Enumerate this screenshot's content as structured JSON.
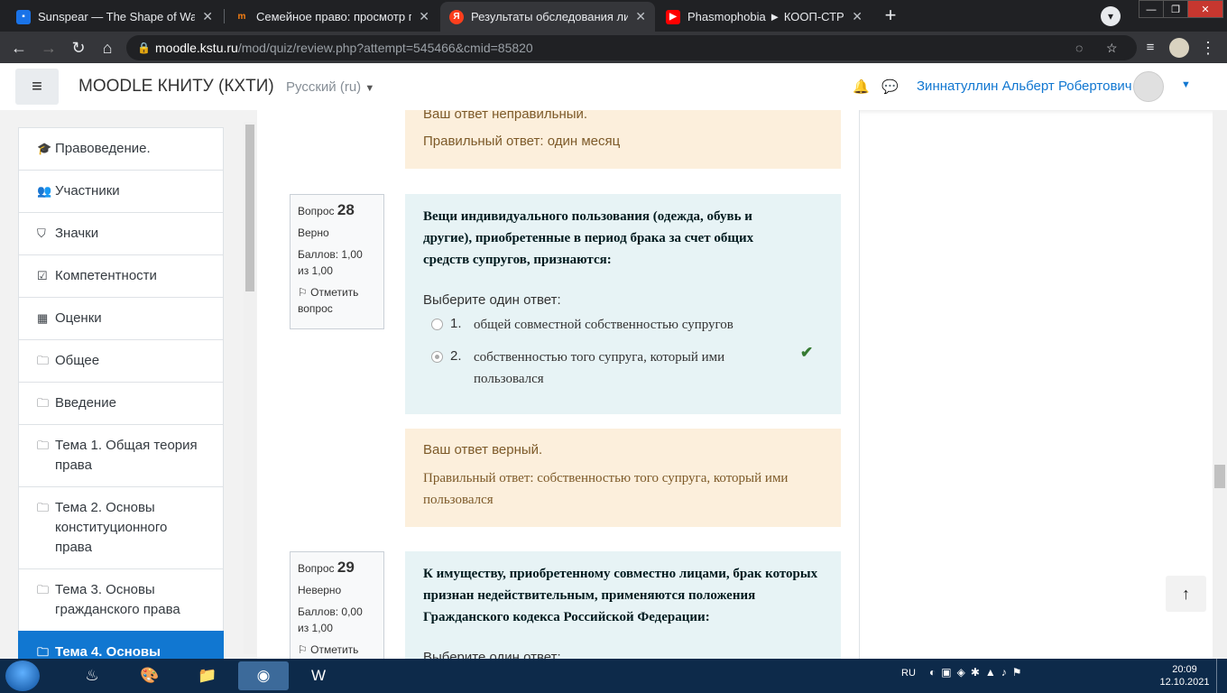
{
  "browser": {
    "tabs": [
      {
        "title": "Sunspear — The Shape of Wax",
        "icon": "chat-favicon-icon",
        "color": "#1a73e8"
      },
      {
        "title": "Семейное право: просмотр попытки",
        "icon": "moodle-favicon-icon",
        "color": "#f98012"
      },
      {
        "title": "Результаты обследования лица...",
        "icon": "yandex-favicon-icon",
        "color": "#fc3f1d"
      },
      {
        "title": "Phasmophobia ► КООП-СТРИМ",
        "icon": "youtube-favicon-icon",
        "color": "#ff0000"
      }
    ],
    "url_host": "moodle.kstu.ru",
    "url_path": "/mod/quiz/review.php?attempt=545466&cmid=85820"
  },
  "header": {
    "site_name": "MOODLE КНИТУ (КХТИ)",
    "language": "Русский (ru)",
    "user_name": "Зиннатуллин Альберт Робертович"
  },
  "drawer": {
    "items": [
      {
        "label": "Правоведение.",
        "icon": "graduation-cap-icon"
      },
      {
        "label": "Участники",
        "icon": "users-icon"
      },
      {
        "label": "Значки",
        "icon": "shield-icon"
      },
      {
        "label": "Компетентности",
        "icon": "checkbox-icon"
      },
      {
        "label": "Оценки",
        "icon": "table-icon"
      },
      {
        "label": "Общее",
        "icon": "folder-icon"
      },
      {
        "label": "Введение",
        "icon": "folder-icon"
      },
      {
        "label": "Тема 1. Общая теория права",
        "icon": "folder-icon"
      },
      {
        "label": "Тема 2. Основы конституционного права",
        "icon": "folder-icon"
      },
      {
        "label": "Тема 3. Основы гражданского права",
        "icon": "folder-icon"
      },
      {
        "label": "Тема 4. Основы",
        "icon": "folder-icon",
        "active": true
      }
    ]
  },
  "prev_feedback": {
    "result": "Ваш ответ неправильный.",
    "correct": "Правильный ответ: один месяц"
  },
  "q28": {
    "label": "Вопрос",
    "number": "28",
    "state": "Верно",
    "grade": "Баллов: 1,00 из 1,00",
    "flag": "Отметить вопрос",
    "text": "Вещи индивидуального пользования (одежда, обувь и другие), приобретенные в период брака за счет общих средств супругов, признаются:",
    "prompt": "Выберите один ответ:",
    "answers": [
      {
        "num": "1.",
        "text": "общей совместной собственностью супругов",
        "checked": false
      },
      {
        "num": "2.",
        "text": "собственностью того супруга, который ими пользовался",
        "checked": true,
        "correct": true
      }
    ],
    "feedback_result": "Ваш ответ верный.",
    "feedback_correct": "Правильный ответ: собственностью того супруга, который ими пользовался"
  },
  "q29": {
    "label": "Вопрос",
    "number": "29",
    "state": "Неверно",
    "grade": "Баллов: 0,00 из 1,00",
    "flag": "Отметить",
    "text": "К имуществу, приобретенному совместно лицами, брак которых признан недействительным, применяются положения Гражданского кодекса Российской Федерации:",
    "prompt": "Выберите один ответ:"
  },
  "taskbar": {
    "language": "RU",
    "time": "20:09",
    "date": "12.10.2021"
  },
  "colors": {
    "accent": "#1177d1",
    "feedback_bg": "#fcefdc",
    "question_bg": "#e7f3f5",
    "correct_green": "#357a32"
  }
}
